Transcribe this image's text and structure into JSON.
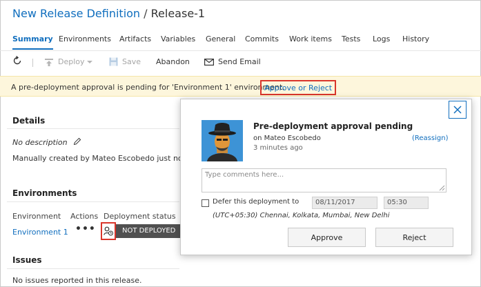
{
  "header": {
    "breadcrumb_link": "New Release Definition",
    "separator": "/",
    "release_name": "Release-1"
  },
  "tabs": [
    {
      "label": "Summary",
      "active": true
    },
    {
      "label": "Environments"
    },
    {
      "label": "Artifacts"
    },
    {
      "label": "Variables"
    },
    {
      "label": "General"
    },
    {
      "label": "Commits"
    },
    {
      "label": "Work items"
    },
    {
      "label": "Tests"
    },
    {
      "label": "Logs"
    },
    {
      "label": "History"
    }
  ],
  "toolbar": {
    "refresh_icon": "refresh-icon",
    "deploy_label": "Deploy",
    "save_label": "Save",
    "abandon_label": "Abandon",
    "send_email_label": "Send Email"
  },
  "notification": {
    "text": "A pre-deployment approval is pending for 'Environment 1' environment.",
    "link": "Approve or Reject"
  },
  "details": {
    "heading": "Details",
    "description": "No description",
    "created_by": "Manually created by Mateo Escobedo just now"
  },
  "environments": {
    "heading": "Environments",
    "columns": [
      "Environment",
      "Actions",
      "Deployment status"
    ],
    "rows": [
      {
        "name": "Environment 1",
        "actions": "•••",
        "status": "NOT DEPLOYED"
      }
    ]
  },
  "issues": {
    "heading": "Issues",
    "text": "No issues reported in this release."
  },
  "popup": {
    "title": "Pre-deployment approval pending",
    "on_behalf": "on Mateo Escobedo",
    "time": "3 minutes ago",
    "reassign": "(Reassign)",
    "comment_placeholder": "Type comments here...",
    "defer_label": "Defer this deployment to",
    "defer_date": "08/11/2017",
    "defer_time": "05:30",
    "timezone": "(UTC+05:30) Chennai, Kolkata, Mumbai, New Delhi",
    "approve_label": "Approve",
    "reject_label": "Reject"
  },
  "colors": {
    "accent": "#106ebe",
    "highlight_border": "#d9352b",
    "notice_bg": "#fdf6dc",
    "status_badge_bg": "#505050"
  }
}
